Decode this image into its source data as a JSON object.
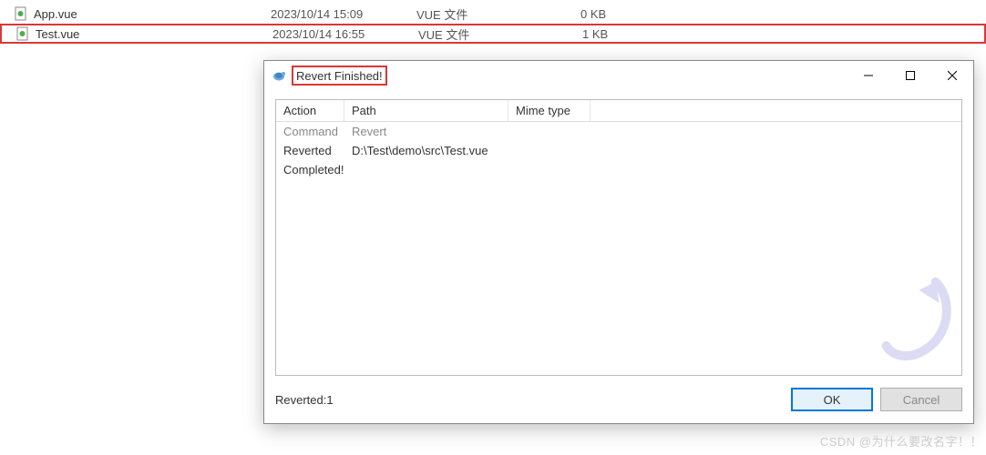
{
  "files": [
    {
      "name": "App.vue",
      "date": "2023/10/14 15:09",
      "type": "VUE 文件",
      "size": "0 KB"
    },
    {
      "name": "Test.vue",
      "date": "2023/10/14 16:55",
      "type": "VUE 文件",
      "size": "1 KB"
    }
  ],
  "dialog": {
    "title": "Revert Finished!",
    "headers": {
      "action": "Action",
      "path": "Path",
      "mime": "Mime type"
    },
    "rows": [
      {
        "kind": "command",
        "action": "Command",
        "path": "Revert",
        "mime": ""
      },
      {
        "kind": "item",
        "action": "Reverted",
        "path": "D:\\Test\\demo\\src\\Test.vue",
        "mime": ""
      },
      {
        "kind": "done",
        "action": "Completed!",
        "path": "",
        "mime": ""
      }
    ],
    "status": "Reverted:1",
    "buttons": {
      "ok": "OK",
      "cancel": "Cancel"
    }
  },
  "watermark": "CSDN @为什么要改名字！！"
}
